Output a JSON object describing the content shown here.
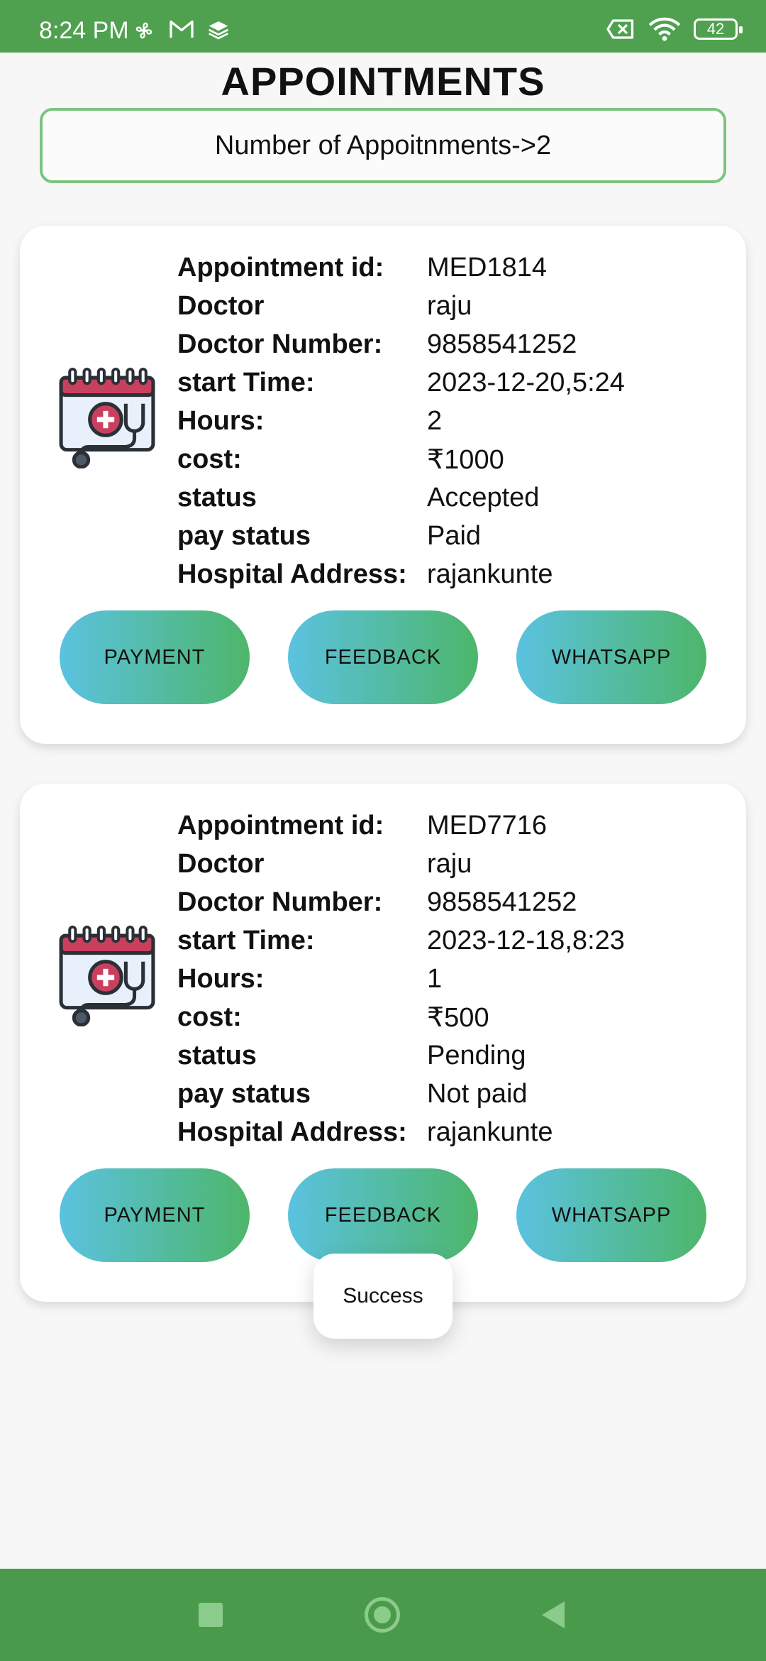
{
  "status_bar": {
    "time": "8:24 PM",
    "battery": "42",
    "icons": [
      "fan-icon",
      "gmail-icon",
      "stack-icon",
      "no-sim-icon",
      "wifi-icon",
      "battery-icon"
    ]
  },
  "header": {
    "title": "APPOINTMENTS",
    "count_text": "Number of Appoitnments->2"
  },
  "labels": {
    "appointment_id": "Appointment id:",
    "doctor": "Doctor",
    "doctor_number": "Doctor Number:",
    "start_time": "start Time:",
    "hours": "Hours:",
    "cost": "cost:",
    "status": "status",
    "pay_status": "pay status",
    "hospital_address": "Hospital Address:"
  },
  "buttons": {
    "payment": "PAYMENT",
    "feedback": "FEEDBACK",
    "whatsapp": "WHATSAPP"
  },
  "appointments": [
    {
      "appointment_id": "MED1814",
      "doctor": "raju",
      "doctor_number": "9858541252",
      "start_time": "2023-12-20,5:24",
      "hours": "2",
      "cost": "₹1000",
      "status": "Accepted",
      "pay_status": "Paid",
      "hospital_address": "rajankunte"
    },
    {
      "appointment_id": "MED7716",
      "doctor": "raju",
      "doctor_number": "9858541252",
      "start_time": "2023-12-18,8:23",
      "hours": "1",
      "cost": "₹500",
      "status": "Pending",
      "pay_status": "Not paid",
      "hospital_address": "rajankunte"
    }
  ],
  "toast": {
    "text": "Success"
  },
  "colors": {
    "status_bar": "#4fa14f",
    "nav_bar": "#4a9a4b",
    "count_border": "#7cc47e",
    "button_gradient_start": "#5bc2e0",
    "button_gradient_end": "#4db66a",
    "calendar_accent": "#c9405f"
  }
}
